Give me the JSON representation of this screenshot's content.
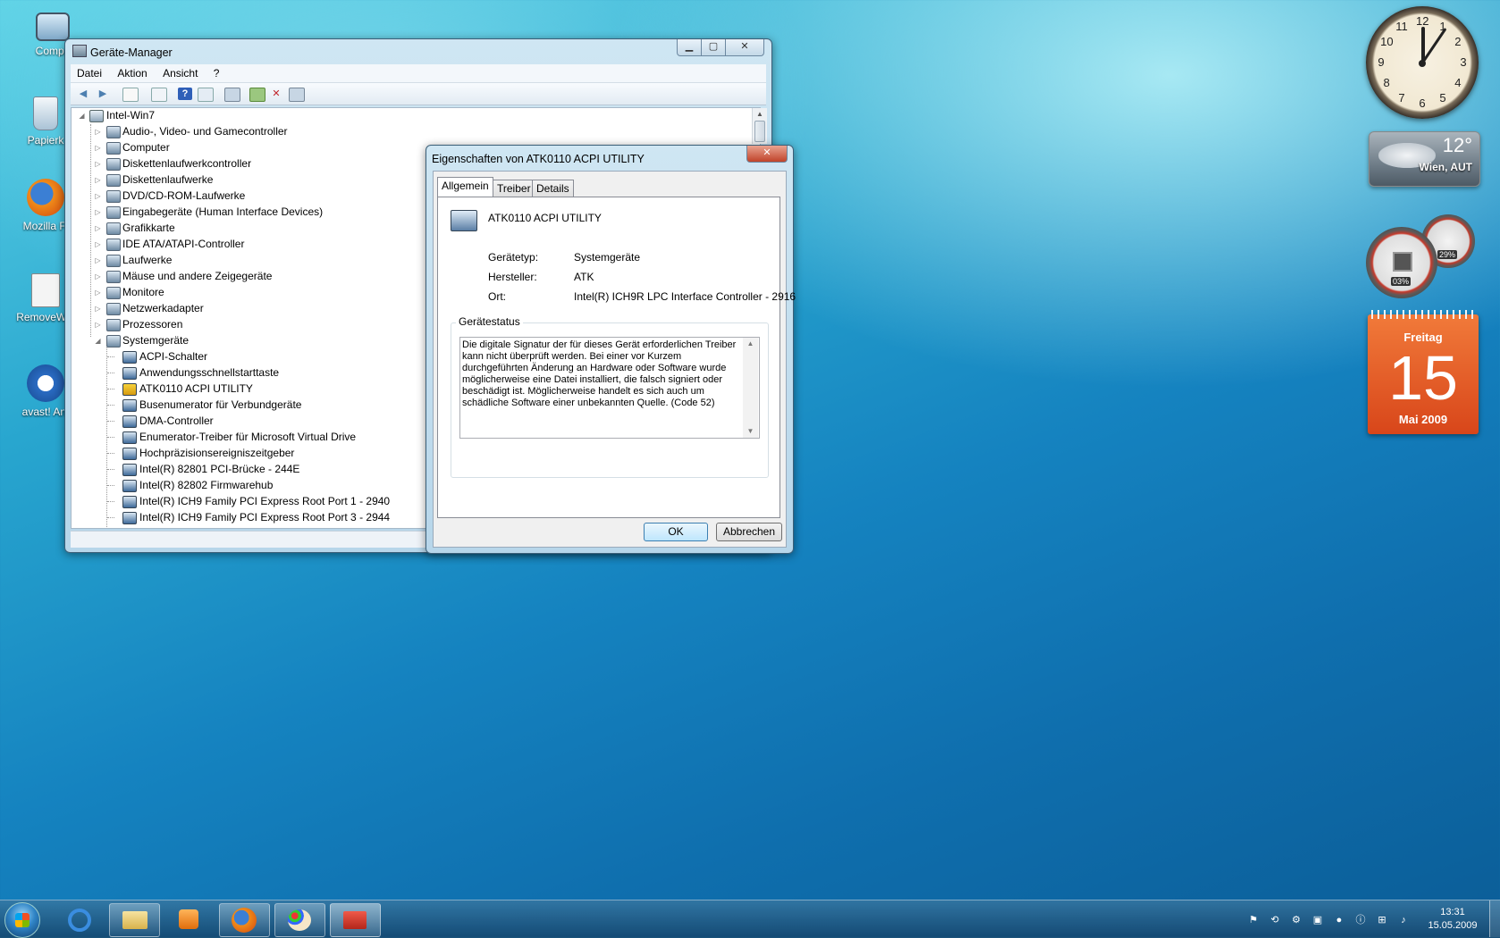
{
  "desktop_icons": [
    {
      "label": "Compu",
      "icon": "computer-icon"
    },
    {
      "label": "Papierk",
      "icon": "recycle-bin-icon"
    },
    {
      "label": "Mozilla Fi",
      "icon": "firefox-icon"
    },
    {
      "label": "RemoveWat",
      "icon": "file-icon"
    },
    {
      "label": "avast! Ant",
      "icon": "avast-icon"
    }
  ],
  "device_manager": {
    "title": "Geräte-Manager",
    "menu": [
      "Datei",
      "Aktion",
      "Ansicht",
      "?"
    ],
    "toolbar_icons": [
      "back-icon",
      "forward-icon",
      "show-hide-tree-icon",
      "properties-icon",
      "help-icon",
      "view-icon",
      "scan-hardware-icon",
      "update-driver-icon",
      "uninstall-icon",
      "disable-icon"
    ],
    "tree": {
      "root": "Intel-Win7",
      "categories": [
        "Audio-, Video- und Gamecontroller",
        "Computer",
        "Diskettenlaufwerkcontroller",
        "Diskettenlaufwerke",
        "DVD/CD-ROM-Laufwerke",
        "Eingabegeräte (Human Interface Devices)",
        "Grafikkarte",
        "IDE ATA/ATAPI-Controller",
        "Laufwerke",
        "Mäuse und andere Zeigegeräte",
        "Monitore",
        "Netzwerkadapter",
        "Prozessoren",
        "Systemgeräte"
      ],
      "system_devices": [
        "ACPI-Schalter",
        "Anwendungsschnellstarttaste",
        "ATK0110 ACPI UTILITY",
        "Busenumerator für Verbundgeräte",
        "DMA-Controller",
        "Enumerator-Treiber für Microsoft Virtual Drive",
        "Hochpräzisionsereigniszeitgeber",
        "Intel(R) 82801 PCI-Brücke - 244E",
        "Intel(R) 82802 Firmwarehub",
        "Intel(R) ICH9 Family PCI Express Root Port 1 - 2940",
        "Intel(R) ICH9 Family PCI Express Root Port 3 - 2944"
      ]
    }
  },
  "properties_dialog": {
    "title": "Eigenschaften von ATK0110 ACPI UTILITY",
    "tabs": [
      "Allgemein",
      "Treiber",
      "Details"
    ],
    "device_name": "ATK0110 ACPI UTILITY",
    "fields": [
      {
        "label": "Gerätetyp:",
        "value": "Systemgeräte"
      },
      {
        "label": "Hersteller:",
        "value": "ATK"
      },
      {
        "label": "Ort:",
        "value": "Intel(R) ICH9R LPC Interface Controller - 2916"
      }
    ],
    "status_group": "Gerätestatus",
    "status_text": "Die digitale Signatur der für dieses Gerät erforderlichen Treiber kann nicht überprüft werden. Bei einer vor Kurzem durchgeführten Änderung an Hardware oder Software wurde möglicherweise eine Datei installiert, die falsch signiert oder beschädigt ist. Möglicherweise handelt es sich auch um schädliche Software einer unbekannten Quelle. (Code 52)",
    "ok": "OK",
    "cancel": "Abbrechen"
  },
  "gadgets": {
    "clock_numbers": [
      "12",
      "1",
      "2",
      "3",
      "4",
      "5",
      "6",
      "7",
      "8",
      "9",
      "10",
      "11"
    ],
    "weather": {
      "temp": "12°",
      "location": "Wien, AUT"
    },
    "cpu_meter": {
      "cpu": "03%",
      "ram": "29%"
    },
    "calendar": {
      "weekday": "Freitag",
      "day": "15",
      "month_year": "Mai 2009"
    }
  },
  "taskbar": {
    "pinned": [
      "start-orb",
      "ie-icon",
      "explorer-icon",
      "media-player-icon",
      "firefox-icon",
      "paint-icon",
      "toolbox-icon"
    ],
    "time": "13:31",
    "date": "15.05.2009"
  },
  "colors": {
    "calendar": "#e0541b",
    "accent": "#3c7fb1"
  }
}
